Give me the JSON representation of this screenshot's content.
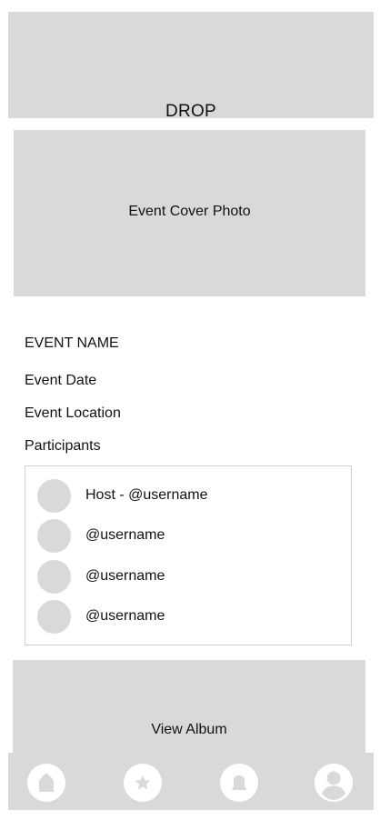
{
  "header": {
    "title": "DROP"
  },
  "cover": {
    "label": "Event Cover Photo"
  },
  "event": {
    "name": "EVENT NAME",
    "date": "Event Date",
    "location": "Event Location",
    "participants_label": "Participants"
  },
  "participants": [
    {
      "name": "Host - @username"
    },
    {
      "name": "@username"
    },
    {
      "name": "@username"
    },
    {
      "name": "@username"
    }
  ],
  "album": {
    "label": "View Album"
  },
  "nav": {
    "items": [
      {
        "icon": "home-icon"
      },
      {
        "icon": "star-icon"
      },
      {
        "icon": "notification-icon"
      },
      {
        "icon": "profile-icon"
      }
    ]
  },
  "colors": {
    "placeholder": "#d9d9d9",
    "border": "#d0d0d0",
    "icon_fill": "#d9d9d9",
    "text": "#111111"
  }
}
